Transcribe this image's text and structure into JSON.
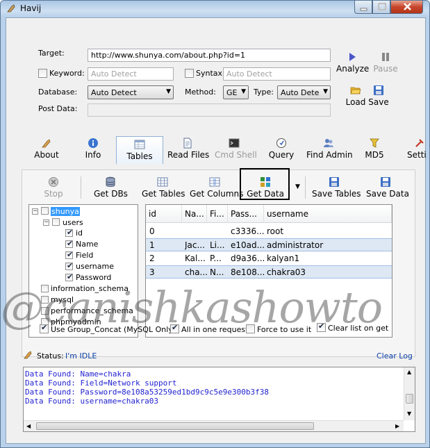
{
  "window": {
    "title": "Havij"
  },
  "form": {
    "target_label": "Target:",
    "target_value": "http://www.shunya.com/about.php?id=1",
    "keyword_label": "Keyword:",
    "keyword_placeholder": "Auto Detect",
    "syntax_label": "Syntax:",
    "syntax_placeholder": "Auto Detect",
    "database_label": "Database:",
    "database_value": "Auto Detect",
    "method_label": "Method:",
    "method_value": "GE",
    "type_label": "Type:",
    "type_value": "Auto Dete",
    "postdata_label": "Post Data:",
    "postdata_value": ""
  },
  "actions": {
    "analyze": "Analyze",
    "pause": "Pause",
    "load": "Load",
    "save": "Save"
  },
  "tabs": [
    {
      "label": "About",
      "icon": "about-icon"
    },
    {
      "label": "Info",
      "icon": "info-icon"
    },
    {
      "label": "Tables",
      "icon": "tables-icon",
      "selected": true
    },
    {
      "label": "Read Files",
      "icon": "file-icon"
    },
    {
      "label": "Cmd Shell",
      "icon": "cmd-icon",
      "disabled": true
    },
    {
      "label": "Query",
      "icon": "query-icon"
    },
    {
      "label": "Find Admin",
      "icon": "admin-icon"
    },
    {
      "label": "MD5",
      "icon": "md5-icon"
    },
    {
      "label": "Setti",
      "icon": "settings-icon"
    }
  ],
  "subtoolbar": {
    "stop": "Stop",
    "get_dbs": "Get DBs",
    "get_tables": "Get Tables",
    "get_columns": "Get Columns",
    "get_data": "Get Data",
    "save_tables": "Save Tables",
    "save_data": "Save Data"
  },
  "tree": {
    "root": "shunya",
    "table": "users",
    "columns": [
      "id",
      "Name",
      "Field",
      "username",
      "Password"
    ],
    "others": [
      "information_schema",
      "mysql",
      "performance_schema",
      "phpmyadmin"
    ]
  },
  "grid": {
    "headers": [
      "id",
      "Na...",
      "Fi...",
      "Pass...",
      "username"
    ],
    "rows": [
      [
        "0",
        "",
        "",
        "c3336...",
        "root"
      ],
      [
        "1",
        "Jac...",
        "Li...",
        "e10ad...",
        "administrator"
      ],
      [
        "2",
        "Kal...",
        "P...",
        "d9a36...",
        "kalyan1"
      ],
      [
        "3",
        "cha...",
        "N...",
        "8e108...",
        "chakra03"
      ]
    ]
  },
  "options": {
    "group_concat": "Use Group_Concat (MySQL Only)",
    "all_in_one": "All in one request.",
    "force": "Force to use it",
    "clear_list": "Clear list on get"
  },
  "status": {
    "label": "Status:",
    "value": "I'm IDLE",
    "clear_log": "Clear Log"
  },
  "log": [
    "Data Found: Name=chakra",
    "Data Found: Field=Network support",
    "Data Found: Password=8e108a53259ed1bd9c9c5e9e300b3f38",
    "Data Found: username=chakra03"
  ],
  "watermark": "@canishkashowto",
  "colors": {
    "selection": "#3399ff",
    "log_text": "#1f1fd0",
    "highlight_box": "#000000"
  }
}
